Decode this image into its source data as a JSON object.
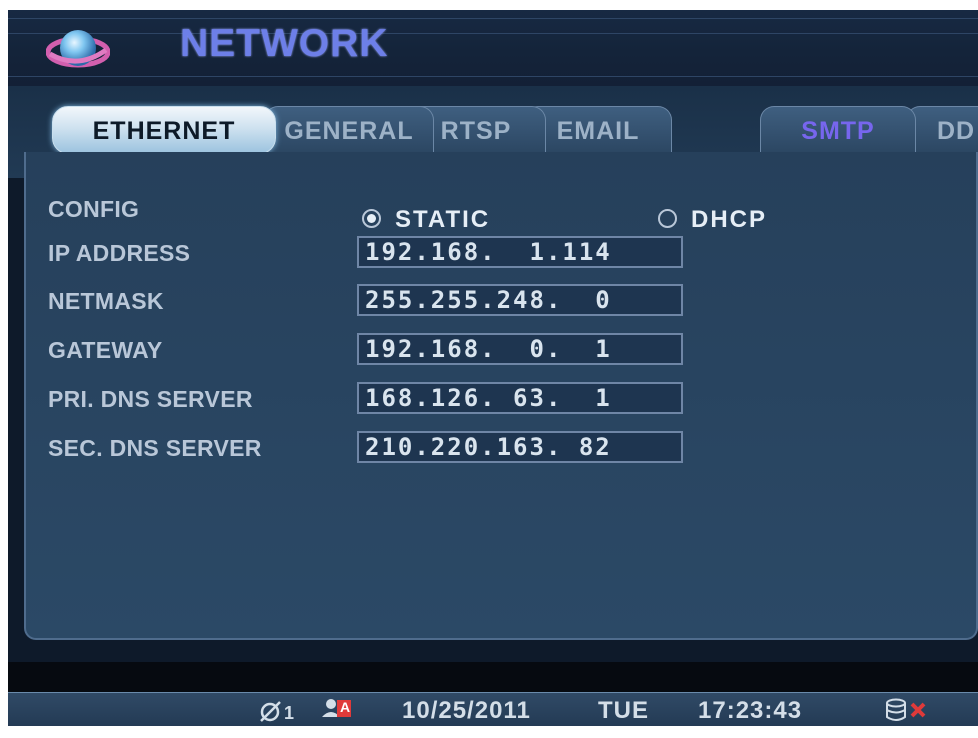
{
  "header": {
    "title": "NETWORK",
    "icon": "globe-icon"
  },
  "tabs": [
    {
      "label": "ETHERNET",
      "active": true
    },
    {
      "label": "GENERAL",
      "active": false
    },
    {
      "label": "RTSP",
      "active": false
    },
    {
      "label": "EMAIL",
      "active": false
    },
    {
      "label": "SMTP",
      "active": false
    },
    {
      "label": "DD",
      "active": false
    }
  ],
  "form": {
    "config_label": "CONFIG",
    "config_options": [
      {
        "label": "STATIC",
        "selected": true
      },
      {
        "label": "DHCP",
        "selected": false
      }
    ],
    "fields": [
      {
        "label": "IP ADDRESS",
        "value": "192.168.  1.114"
      },
      {
        "label": "NETMASK",
        "value": "255.255.248.  0"
      },
      {
        "label": "GATEWAY",
        "value": "192.168.  0.  1"
      },
      {
        "label": "PRI. DNS SERVER",
        "value": "168.126. 63.  1"
      },
      {
        "label": "SEC. DNS SERVER",
        "value": "210.220.163. 82"
      }
    ]
  },
  "status_bar": {
    "network_count": "1",
    "user_icon_letter": "A",
    "date": "10/25/2011",
    "weekday": "TUE",
    "time": "17:23:43"
  },
  "colors": {
    "title": "#6d7fe8",
    "purple_tab": "#7766ee",
    "panel": "#26405b",
    "alert_red": "#e03a3a"
  }
}
